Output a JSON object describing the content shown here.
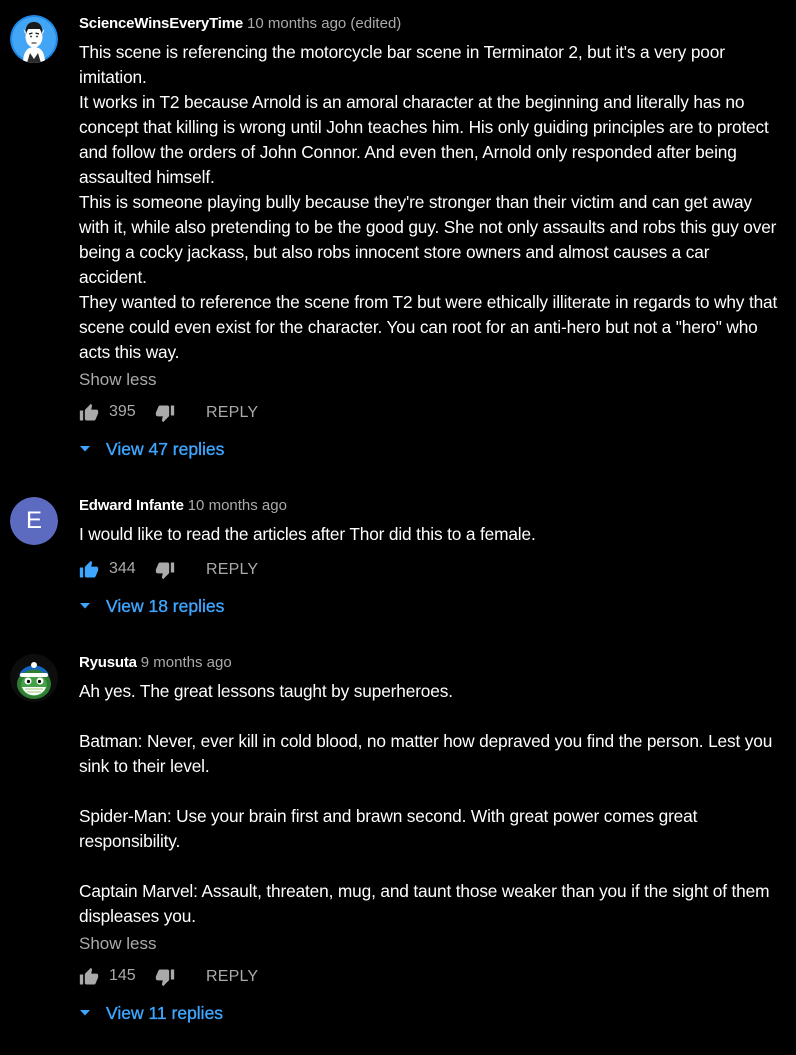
{
  "colors": {
    "background": "#000000",
    "text_primary": "#ffffff",
    "text_secondary": "#aaaaaa",
    "link_blue": "#3ea6ff",
    "liked_blue": "#3ea6ff",
    "avatar_e": "#5c6bc0"
  },
  "comments": [
    {
      "author": "ScienceWinsEveryTime",
      "time": "10 months ago (edited)",
      "avatar_icon": "spock-avatar",
      "paragraphs": [
        "This scene is referencing the motorcycle bar scene in Terminator 2, but it's a very poor imitation.",
        "It works in T2 because Arnold is an amoral character at the beginning and literally has no concept that killing is wrong until John teaches him. His only guiding principles are to protect and follow the orders of John Connor. And even then, Arnold only responded after being assaulted himself.",
        "This is someone playing bully because they're stronger than their victim and can get away with it, while also pretending to be the good guy. She not only assaults and robs this guy over being a cocky jackass, but also robs innocent store owners and almost causes a car accident.",
        "They wanted to reference the scene from T2 but were ethically illiterate in regards to why that scene could even exist for the character. You can root for an anti-hero but not a \"hero\" who acts this way."
      ],
      "show_less": "Show less",
      "likes": "395",
      "reply": "REPLY",
      "view_replies": "View 47 replies",
      "liked": false
    },
    {
      "author": "Edward Infante",
      "time": "10 months ago",
      "avatar_letter": "E",
      "paragraphs": [
        "I would like to read the articles after Thor did this to a female."
      ],
      "likes": "344",
      "reply": "REPLY",
      "view_replies": "View 18 replies",
      "liked": true
    },
    {
      "author": "Ryusuta",
      "time": "9 months ago",
      "avatar_icon": "grinning-mascot-avatar",
      "paragraphs": [
        "Ah yes. The great lessons taught by superheroes.",
        "",
        "Batman: Never, ever kill in cold blood, no matter how depraved you find the person. Lest you sink to their level.",
        "",
        "Spider-Man: Use your brain first and brawn second. With great power comes great responsibility.",
        "",
        "Captain Marvel: Assault, threaten, mug, and taunt those weaker than you if the sight of them displeases you."
      ],
      "show_less": "Show less",
      "likes": "145",
      "reply": "REPLY",
      "view_replies": "View 11 replies",
      "liked": false
    }
  ]
}
